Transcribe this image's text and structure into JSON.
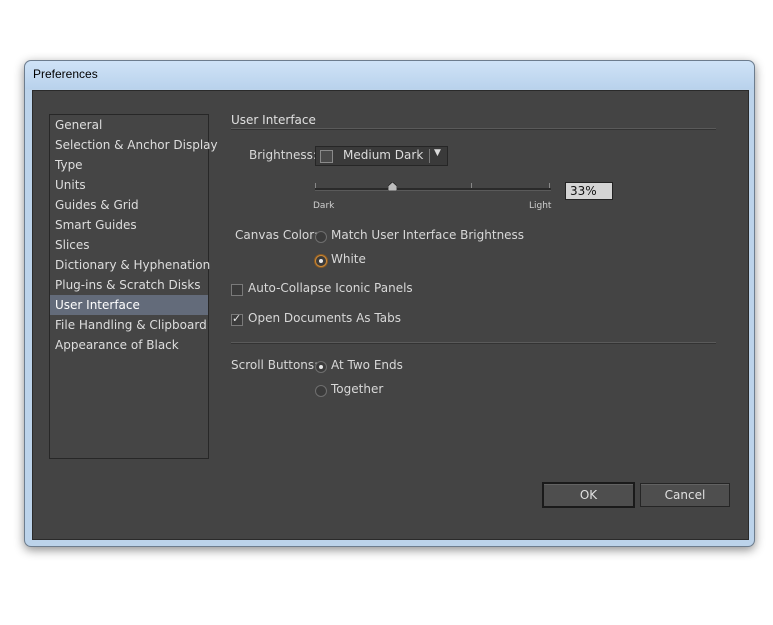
{
  "window": {
    "title": "Preferences"
  },
  "nav": {
    "items": [
      {
        "label": "General"
      },
      {
        "label": "Selection & Anchor Display"
      },
      {
        "label": "Type"
      },
      {
        "label": "Units"
      },
      {
        "label": "Guides & Grid"
      },
      {
        "label": "Smart Guides"
      },
      {
        "label": "Slices"
      },
      {
        "label": "Dictionary & Hyphenation"
      },
      {
        "label": "Plug-ins & Scratch Disks"
      },
      {
        "label": "User Interface"
      },
      {
        "label": "File Handling & Clipboard"
      },
      {
        "label": "Appearance of Black"
      }
    ],
    "selected_index": 9
  },
  "panel": {
    "heading": "User Interface",
    "brightness": {
      "label": "Brightness:",
      "value": "Medium Dark",
      "slider_min_label": "Dark",
      "slider_max_label": "Light",
      "percent_text": "33%",
      "slider_fraction": 0.33
    },
    "canvas_color": {
      "label": "Canvas Color:",
      "options": [
        {
          "label": "Match User Interface Brightness",
          "selected": false
        },
        {
          "label": "White",
          "selected": true
        }
      ]
    },
    "auto_collapse": {
      "label": "Auto-Collapse Iconic Panels",
      "checked": false
    },
    "open_docs_tabs": {
      "label": "Open Documents As Tabs",
      "checked": true
    },
    "scroll_buttons": {
      "label": "Scroll Buttons:",
      "options": [
        {
          "label": "At Two Ends",
          "selected": true
        },
        {
          "label": "Together",
          "selected": false
        }
      ]
    }
  },
  "buttons": {
    "ok": "OK",
    "cancel": "Cancel"
  },
  "colors": {
    "panel_bg": "#444444",
    "selection_bg": "#636b7a",
    "radio_accent": "#c9893a",
    "titlebar": "#bcd3ea"
  }
}
